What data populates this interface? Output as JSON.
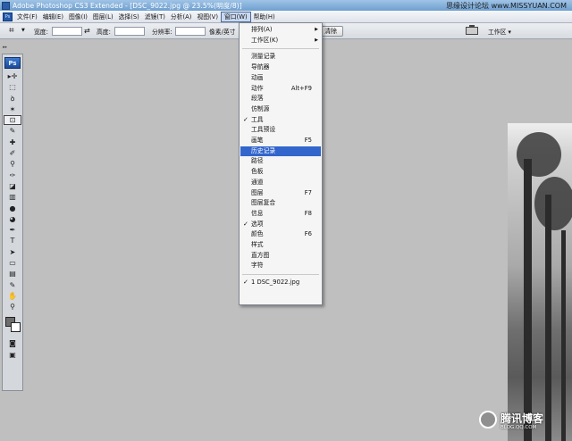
{
  "window": {
    "title": "Adobe Photoshop CS3 Extended - [DSC_9022.jpg @ 23.5%(明度/8)]"
  },
  "watermark_top": "思缘设计论坛 www.MISSYUAN.COM",
  "menubar": {
    "items": [
      "文件(F)",
      "编辑(E)",
      "图像(I)",
      "图层(L)",
      "选择(S)",
      "滤镜(T)",
      "分析(A)",
      "视图(V)",
      "窗口(W)",
      "帮助(H)"
    ],
    "active": "窗口(W)"
  },
  "optionsbar": {
    "width_label": "宽度:",
    "height_label": "高度:",
    "resolution_label": "分辨率:",
    "resolution_unit": "像素/英寸",
    "clear_label": "清除",
    "workspace_label": "工作区 ▾"
  },
  "toolbox": {
    "logo": "Ps",
    "tools": [
      "move-icon",
      "marquee-icon",
      "lasso-icon",
      "magic-wand-icon",
      "crop-icon",
      "slice-icon",
      "healing-icon",
      "brush-icon",
      "clone-stamp-icon",
      "history-brush-icon",
      "eraser-icon",
      "gradient-icon",
      "blur-icon",
      "dodge-icon",
      "pen-icon",
      "type-icon",
      "path-select-icon",
      "shape-icon",
      "notes-icon",
      "eyedropper-icon",
      "hand-icon",
      "zoom-icon"
    ],
    "tool_glyphs": [
      "▸✛",
      "⬚",
      "ꝺ",
      "✶",
      "⊡",
      "✎",
      "✚",
      "✐",
      "⚲",
      "✑",
      "◪",
      "▥",
      "●",
      "◕",
      "✒",
      "T",
      "➤",
      "▭",
      "▤",
      "✎",
      "✋",
      "⚲"
    ],
    "selected_index": 4,
    "foreground_color": "#6d6d6d",
    "background_color": "#ffffff"
  },
  "window_menu": {
    "items": [
      {
        "label": "排列(A)",
        "submenu": true
      },
      {
        "label": "工作区(K)",
        "submenu": true
      },
      {
        "separator": true
      },
      {
        "label": "测量记录"
      },
      {
        "label": "导航器"
      },
      {
        "label": "动画"
      },
      {
        "label": "动作",
        "shortcut": "Alt+F9"
      },
      {
        "label": "段落"
      },
      {
        "label": "仿制源"
      },
      {
        "label": "工具",
        "checked": true
      },
      {
        "label": "工具预设"
      },
      {
        "label": "画笔",
        "shortcut": "F5"
      },
      {
        "label": "历史记录",
        "highlighted": true
      },
      {
        "label": "路径"
      },
      {
        "label": "色板"
      },
      {
        "label": "通道"
      },
      {
        "label": "图层",
        "shortcut": "F7"
      },
      {
        "label": "图层复合"
      },
      {
        "label": "信息",
        "shortcut": "F8"
      },
      {
        "label": "选项",
        "checked": true
      },
      {
        "label": "颜色",
        "shortcut": "F6"
      },
      {
        "label": "样式"
      },
      {
        "label": "直方图"
      },
      {
        "label": "字符"
      },
      {
        "separator": true
      },
      {
        "label": "1 DSC_9022.jpg",
        "checked": true
      }
    ]
  },
  "image_watermark": {
    "title": "腾讯博客",
    "url": "BLOG.QQ.COM"
  }
}
